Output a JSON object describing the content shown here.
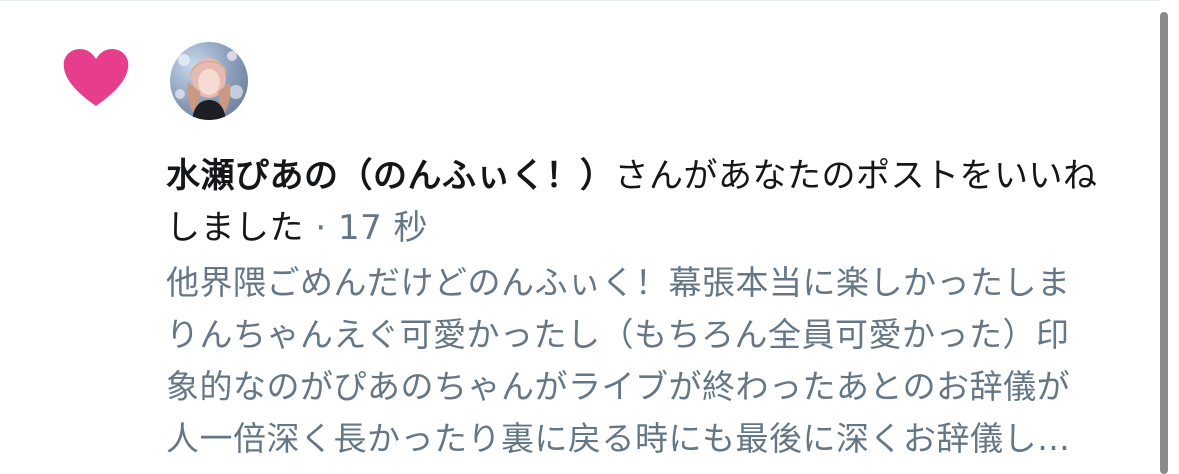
{
  "notification": {
    "icon": "heart-icon",
    "icon_color": "#e0245e",
    "user_name": "水瀬ぴあの（のんふぃく！）",
    "action_text": "さんがあなたのポストをいいね",
    "action_text_cont": "しました",
    "separator": "·",
    "timestamp": "17 秒",
    "post_preview_lines": [
      "他界隈ごめんだけどのんふぃく！幕張本当に楽しかったしま",
      "りんちゃんえぐ可愛かったし（もちろん全員可愛かった）印",
      "象的なのがぴあのちゃんがライブが終わったあとのお辞儀が",
      "人一倍深く長かったり裏に戻る時にも最後に深くお辞儀し…"
    ]
  },
  "colors": {
    "text_primary": "#14171a",
    "text_secondary": "#657786",
    "like_pink": "#e0245e"
  }
}
